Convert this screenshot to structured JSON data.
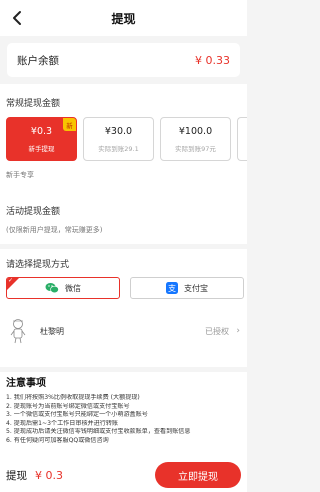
{
  "header": {
    "title": "提现",
    "back_icon": "back-arrow-icon"
  },
  "balance": {
    "label": "账户余额",
    "value": "¥ 0.33"
  },
  "regular": {
    "title": "常规提现金额",
    "options": [
      {
        "amount": "¥0.3",
        "sub": "新手提现",
        "badge": "新",
        "selected": true
      },
      {
        "amount": "¥30.0",
        "sub": "实际到账29.1",
        "selected": false
      },
      {
        "amount": "¥100.0",
        "sub": "实际到账97元",
        "selected": false
      }
    ],
    "newbie_note": "新手专享"
  },
  "activity": {
    "title": "活动提现金额",
    "note": "(仅限新用户提现，常玩赚更多)"
  },
  "method": {
    "title": "请选择提现方式",
    "options": [
      {
        "label": "微信",
        "icon": "wechat-icon",
        "selected": true
      },
      {
        "label": "支付宝",
        "icon": "alipay-icon",
        "selected": false
      }
    ],
    "user": {
      "name": "杜黎明",
      "status": "已授权",
      "chevron": "›"
    }
  },
  "notes": {
    "title": "注意事项",
    "items": [
      "1. 我们将按照3%比例收取提现手续费 (大额提现)",
      "2. 提现账号为当前账号绑定微信或支付宝账号",
      "3. 一个微信或支付宝账号只能绑定一个小萌游盒账号",
      "4. 提现后需1~3个工作日审核并进行转账",
      "5. 提现成功后请关注微信零钱明细或支付宝收款账单，查看到账信息",
      "6. 有任何疑问可加客服QQ或微信咨询"
    ]
  },
  "footer": {
    "label": "提现",
    "value": "¥ 0.3",
    "button": "立即提现"
  },
  "colors": {
    "accent": "#e8322a",
    "badge": "#f8c400",
    "wechat": "#2aae67",
    "alipay": "#1677ff"
  }
}
